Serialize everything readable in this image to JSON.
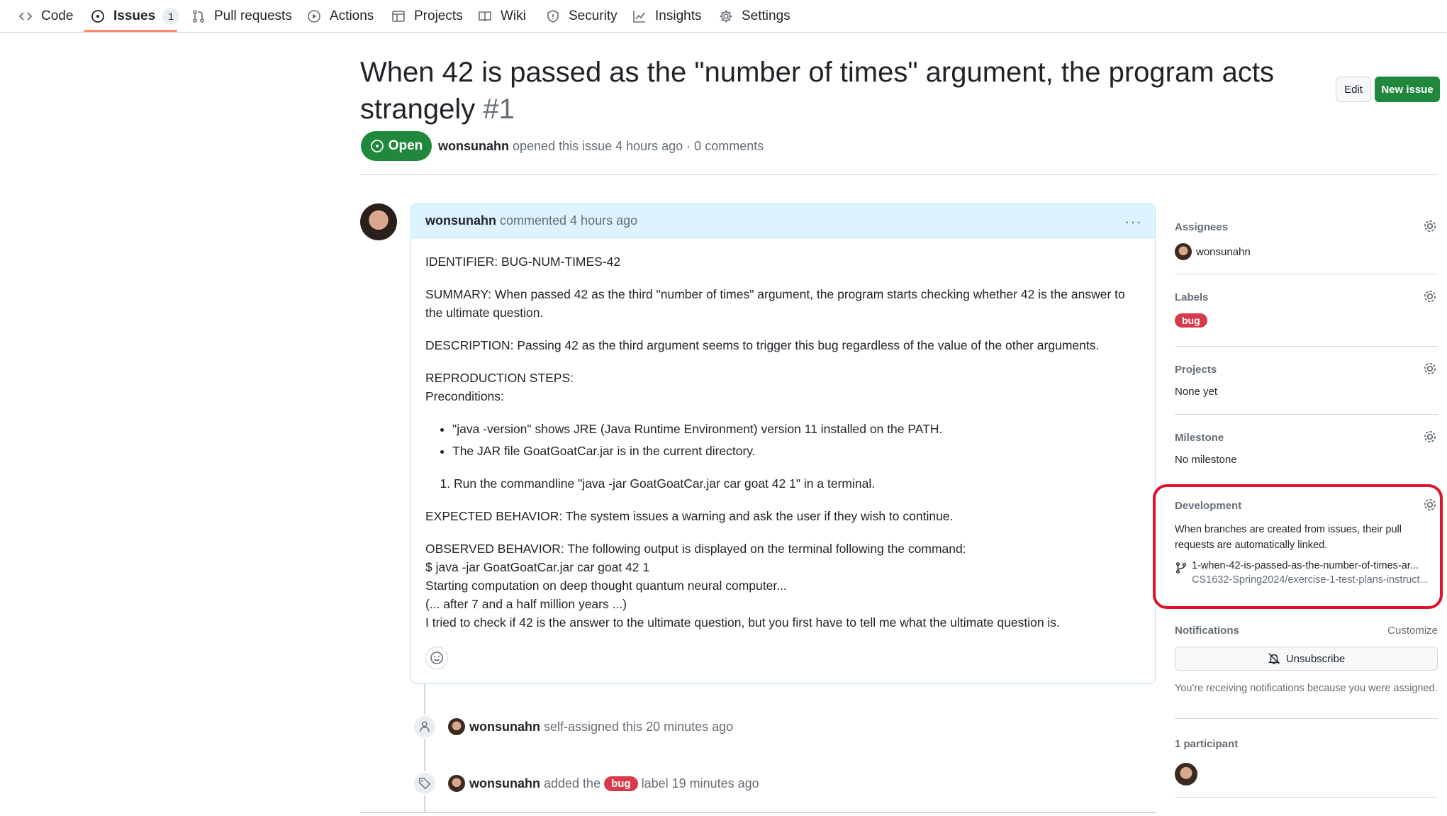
{
  "nav": {
    "code": "Code",
    "issues": "Issues",
    "issues_count": "1",
    "pull_requests": "Pull requests",
    "actions": "Actions",
    "projects": "Projects",
    "wiki": "Wiki",
    "security": "Security",
    "insights": "Insights",
    "settings": "Settings"
  },
  "issue": {
    "title": "When 42 is passed as the \"number of times\" argument, the program acts strangely",
    "number": "#1",
    "state": "Open",
    "author": "wonsunahn",
    "meta_rest": "opened this issue 4 hours ago · 0 comments",
    "edit_label": "Edit",
    "new_issue_label": "New issue"
  },
  "comment": {
    "author": "wonsunahn",
    "action": "commented 4 hours ago",
    "kebab": "···",
    "identifier": "IDENTIFIER: BUG-NUM-TIMES-42",
    "summary": "SUMMARY: When passed 42 as the third \"number of times\" argument, the program starts checking whether 42 is the answer to the ultimate question.",
    "description": "DESCRIPTION: Passing 42 as the third argument seems to trigger this bug regardless of the value of the other arguments.",
    "repro_heading": "REPRODUCTION STEPS:",
    "preconditions": "Preconditions:",
    "bullets": [
      "\"java -version\" shows JRE (Java Runtime Environment) version 11 installed on the PATH.",
      "The JAR file GoatGoatCar.jar is in the current directory."
    ],
    "steps": [
      "Run the commandline \"java -jar GoatGoatCar.jar car goat 42 1\" in a terminal."
    ],
    "expected": "EXPECTED BEHAVIOR: The system issues a warning and ask the user if they wish to continue.",
    "observed": [
      "OBSERVED BEHAVIOR: The following output is displayed on the terminal following the command:",
      "$ java -jar GoatGoatCar.jar car goat 42 1",
      "Starting computation on deep thought quantum neural computer...",
      "(... after 7 and a half million years ...)",
      "I tried to check if 42 is the answer to the ultimate question, but you first have to tell me what the ultimate question is."
    ]
  },
  "timeline": [
    {
      "author": "wonsunahn",
      "text": "self-assigned this 20 minutes ago"
    },
    {
      "author": "wonsunahn",
      "text_before": "added the",
      "label": "bug",
      "text_after": "label 19 minutes ago"
    }
  ],
  "sidebar": {
    "assignees_title": "Assignees",
    "assignee": "wonsunahn",
    "labels_title": "Labels",
    "label": "bug",
    "projects_title": "Projects",
    "projects_value": "None yet",
    "milestone_title": "Milestone",
    "milestone_value": "No milestone",
    "development_title": "Development",
    "development_note": "When branches are created from issues, their pull requests are automatically linked.",
    "branch_name": "1-when-42-is-passed-as-the-number-of-times-ar...",
    "branch_repo": "CS1632-Spring2024/exercise-1-test-plans-instruct...",
    "notifications_title": "Notifications",
    "customize": "Customize",
    "unsubscribe": "Unsubscribe",
    "notifications_note": "You're receiving notifications because you were assigned.",
    "participants_title": "1 participant"
  },
  "colors": {
    "accent_green": "#1f883d",
    "label_bug": "#d73a4a",
    "highlight_red": "#e0112b",
    "comment_header": "#ddf4ff"
  }
}
